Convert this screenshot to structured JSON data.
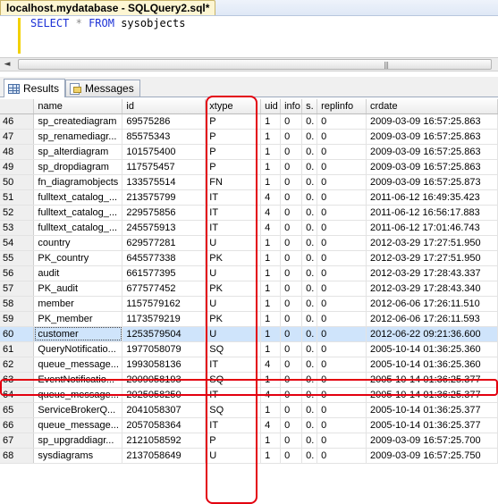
{
  "document_tab": {
    "title": "localhost.mydatabase - SQLQuery2.sql*"
  },
  "editor": {
    "kw_select": "SELECT",
    "op_star": "*",
    "kw_from": "FROM",
    "table": "sysobjects"
  },
  "scrollbar": {
    "left_arrow": "◄",
    "grip": "|||"
  },
  "results_tabs": [
    {
      "label": "Results",
      "icon": "grid-icon",
      "active": true
    },
    {
      "label": "Messages",
      "icon": "messages-icon",
      "active": false
    }
  ],
  "grid": {
    "columns": [
      "name",
      "id",
      "xtype",
      "uid",
      "info",
      "s.",
      "replinfo",
      "crdate"
    ],
    "rows": [
      [
        "46",
        "sp_creatediagram",
        "69575286",
        "P",
        "1",
        "0",
        "0.",
        "0",
        "2009-03-09 16:57:25.863"
      ],
      [
        "47",
        "sp_renamediagr...",
        "85575343",
        "P",
        "1",
        "0",
        "0.",
        "0",
        "2009-03-09 16:57:25.863"
      ],
      [
        "48",
        "sp_alterdiagram",
        "101575400",
        "P",
        "1",
        "0",
        "0.",
        "0",
        "2009-03-09 16:57:25.863"
      ],
      [
        "49",
        "sp_dropdiagram",
        "117575457",
        "P",
        "1",
        "0",
        "0.",
        "0",
        "2009-03-09 16:57:25.863"
      ],
      [
        "50",
        "fn_diagramobjects",
        "133575514",
        "FN",
        "1",
        "0",
        "0.",
        "0",
        "2009-03-09 16:57:25.873"
      ],
      [
        "51",
        "fulltext_catalog_...",
        "213575799",
        "IT",
        "4",
        "0",
        "0.",
        "0",
        "2011-06-12 16:49:35.423"
      ],
      [
        "52",
        "fulltext_catalog_...",
        "229575856",
        "IT",
        "4",
        "0",
        "0.",
        "0",
        "2011-06-12 16:56:17.883"
      ],
      [
        "53",
        "fulltext_catalog_...",
        "245575913",
        "IT",
        "4",
        "0",
        "0.",
        "0",
        "2011-06-12 17:01:46.743"
      ],
      [
        "54",
        "country",
        "629577281",
        "U",
        "1",
        "0",
        "0.",
        "0",
        "2012-03-29 17:27:51.950"
      ],
      [
        "55",
        "PK_country",
        "645577338",
        "PK",
        "1",
        "0",
        "0.",
        "0",
        "2012-03-29 17:27:51.950"
      ],
      [
        "56",
        "audit",
        "661577395",
        "U",
        "1",
        "0",
        "0.",
        "0",
        "2012-03-29 17:28:43.337"
      ],
      [
        "57",
        "PK_audit",
        "677577452",
        "PK",
        "1",
        "0",
        "0.",
        "0",
        "2012-03-29 17:28:43.340"
      ],
      [
        "58",
        "member",
        "1157579162",
        "U",
        "1",
        "0",
        "0.",
        "0",
        "2012-06-06 17:26:11.510"
      ],
      [
        "59",
        "PK_member",
        "1173579219",
        "PK",
        "1",
        "0",
        "0.",
        "0",
        "2012-06-06 17:26:11.593"
      ],
      [
        "60",
        "customer",
        "1253579504",
        "U",
        "1",
        "0",
        "0.",
        "0",
        "2012-06-22 09:21:36.600"
      ],
      [
        "61",
        "QueryNotificatio...",
        "1977058079",
        "SQ",
        "1",
        "0",
        "0.",
        "0",
        "2005-10-14 01:36:25.360"
      ],
      [
        "62",
        "queue_message...",
        "1993058136",
        "IT",
        "4",
        "0",
        "0.",
        "0",
        "2005-10-14 01:36:25.360"
      ],
      [
        "63",
        "EventNotificatio...",
        "2009058193",
        "SQ",
        "1",
        "0",
        "0.",
        "0",
        "2005-10-14 01:36:25.377"
      ],
      [
        "64",
        "queue_message...",
        "2025058250",
        "IT",
        "4",
        "0",
        "0.",
        "0",
        "2005-10-14 01:36:25.377"
      ],
      [
        "65",
        "ServiceBrokerQ...",
        "2041058307",
        "SQ",
        "1",
        "0",
        "0.",
        "0",
        "2005-10-14 01:36:25.377"
      ],
      [
        "66",
        "queue_message...",
        "2057058364",
        "IT",
        "4",
        "0",
        "0.",
        "0",
        "2005-10-14 01:36:25.377"
      ],
      [
        "67",
        "sp_upgraddiagr...",
        "2121058592",
        "P",
        "1",
        "0",
        "0.",
        "0",
        "2009-03-09 16:57:25.700"
      ],
      [
        "68",
        "sysdiagrams",
        "2137058649",
        "U",
        "1",
        "0",
        "0.",
        "0",
        "2009-03-09 16:57:25.750"
      ]
    ],
    "selected_row": "60"
  },
  "colors": {
    "highlight": "#e3000f",
    "selected_row": "#cfe4fb",
    "keyword": "#1c31d6"
  }
}
